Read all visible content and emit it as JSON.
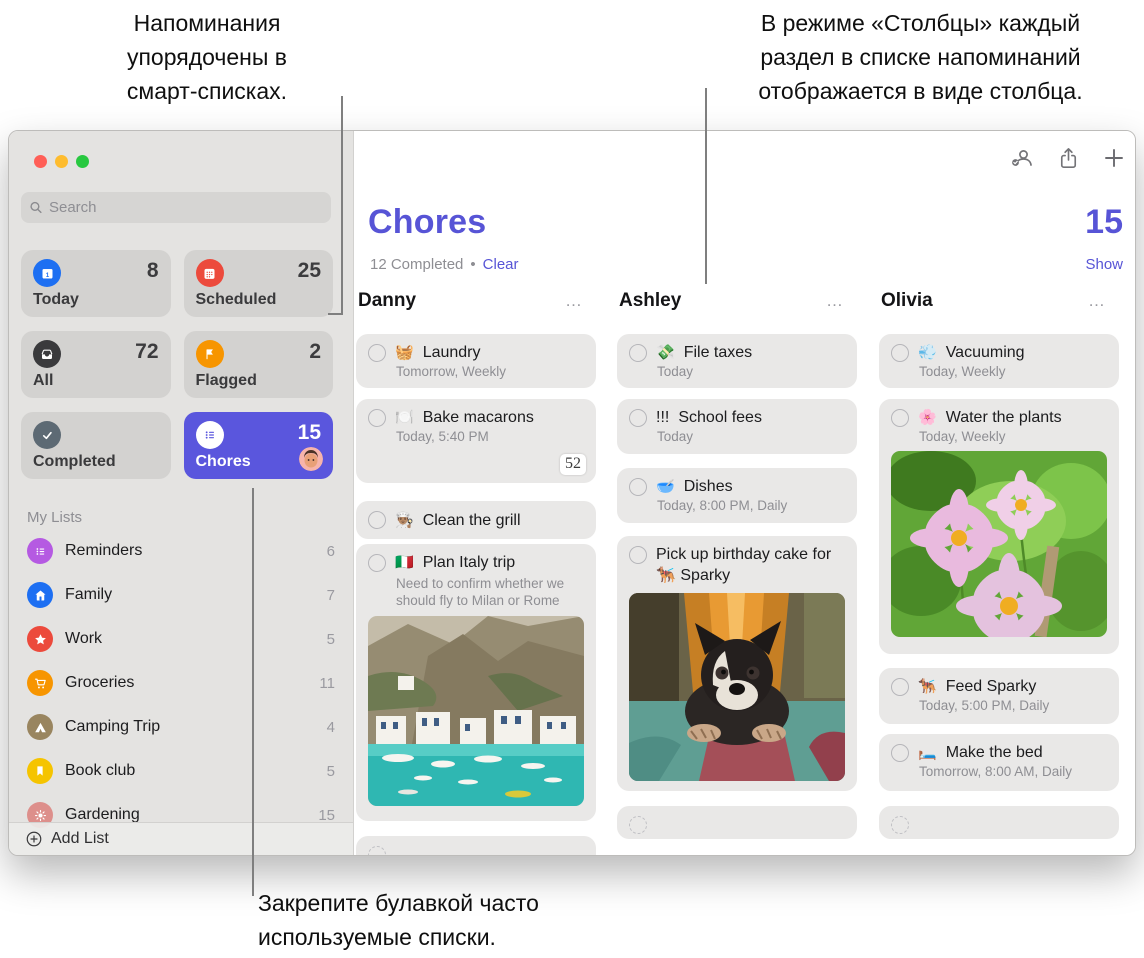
{
  "callouts": {
    "top_left": "Напоминания\nупорядочены в\nсмарт-списках.",
    "top_right": "В режиме «Столбцы» каждый\nраздел в списке напоминаний\nотображается в виде столбца.",
    "bottom": "Закрепите булавкой часто\nиспользуемые списки."
  },
  "window": {
    "sidebar": {
      "search_placeholder": "Search",
      "smart_lists": [
        {
          "label": "Today",
          "count": "8",
          "icon": "calendar-today-icon",
          "color": "#1d6ff2"
        },
        {
          "label": "Scheduled",
          "count": "25",
          "icon": "calendar-grid-icon",
          "color": "#ec4a3c"
        },
        {
          "label": "All",
          "count": "72",
          "icon": "inbox-tray-icon",
          "color": "#3a3a3c"
        },
        {
          "label": "Flagged",
          "count": "2",
          "icon": "flag-icon",
          "color": "#f79500"
        },
        {
          "label": "Completed",
          "count": "",
          "icon": "checkmark-icon",
          "color": "#5d6a74"
        },
        {
          "label": "Chores",
          "count": "15",
          "icon": "bullet-list-icon",
          "color": "#5a56dd",
          "selected": true,
          "avatar": "memoji-avatar"
        }
      ],
      "my_lists_header": "My Lists",
      "my_lists": [
        {
          "label": "Reminders",
          "count": "6",
          "icon": "bullet-list-icon",
          "color": "#b55ae2"
        },
        {
          "label": "Family",
          "count": "7",
          "icon": "house-icon",
          "color": "#1d6ff2"
        },
        {
          "label": "Work",
          "count": "5",
          "icon": "star-icon",
          "color": "#ec4a3c"
        },
        {
          "label": "Groceries",
          "count": "11",
          "icon": "cart-icon",
          "color": "#f79500"
        },
        {
          "label": "Camping Trip",
          "count": "4",
          "icon": "tent-icon",
          "color": "#99855f"
        },
        {
          "label": "Book club",
          "count": "5",
          "icon": "bookmark-icon",
          "color": "#f5c400"
        },
        {
          "label": "Gardening",
          "count": "15",
          "icon": "sun-icon",
          "color": "#dd8f8b"
        }
      ],
      "add_list_label": "Add List"
    },
    "toolbar_icons": [
      "shared-contact-icon",
      "share-icon",
      "add-reminder-icon"
    ],
    "header": {
      "title": "Chores",
      "accent_color": "#5754d6",
      "completed_summary": "12 Completed",
      "dot": "•",
      "clear_label": "Clear",
      "total_count": "15",
      "show_label": "Show"
    },
    "columns": [
      {
        "name": "Danny",
        "menu_ellipsis": "…",
        "cards": [
          {
            "emoji": "🧺",
            "title": "Laundry",
            "subtitle": "Tomorrow, Weekly"
          },
          {
            "emoji": "🍽️",
            "title": "Bake macarons",
            "subtitle": "Today, 5:40 PM",
            "thumbnail_label": "52"
          },
          {
            "emoji": "👨🏽‍🍳",
            "title": "Clean the grill"
          },
          {
            "emoji": "🇮🇹",
            "title": "Plan Italy trip",
            "note": "Need to confirm whether we should fly to Milan or Rome",
            "photo": "italy-harbor-photo"
          },
          {
            "empty": true
          }
        ]
      },
      {
        "name": "Ashley",
        "menu_ellipsis": "…",
        "cards": [
          {
            "emoji": "💸",
            "title": "File taxes",
            "subtitle": "Today"
          },
          {
            "priority": "!!!",
            "title": "School fees",
            "subtitle": "Today"
          },
          {
            "emoji": "🥣",
            "title": "Dishes",
            "subtitle": "Today, 8:00 PM, Daily"
          },
          {
            "title": "Pick up birthday cake for 🐕‍🦺 Sparky",
            "photo": "dog-on-rug-photo"
          },
          {
            "empty": true
          }
        ]
      },
      {
        "name": "Olivia",
        "menu_ellipsis": "…",
        "cards": [
          {
            "emoji": "💨",
            "title": "Vacuuming",
            "subtitle": "Today, Weekly"
          },
          {
            "emoji": "🌸",
            "title": "Water the plants",
            "subtitle": "Today, Weekly",
            "photo": "cosmos-flowers-photo"
          },
          {
            "emoji": "🐕‍🦺",
            "title": "Feed Sparky",
            "subtitle": "Today, 5:00 PM, Daily"
          },
          {
            "emoji": "🛏️",
            "title": "Make the bed",
            "subtitle": "Tomorrow, 8:00 AM, Daily"
          },
          {
            "empty": true
          }
        ]
      }
    ]
  }
}
